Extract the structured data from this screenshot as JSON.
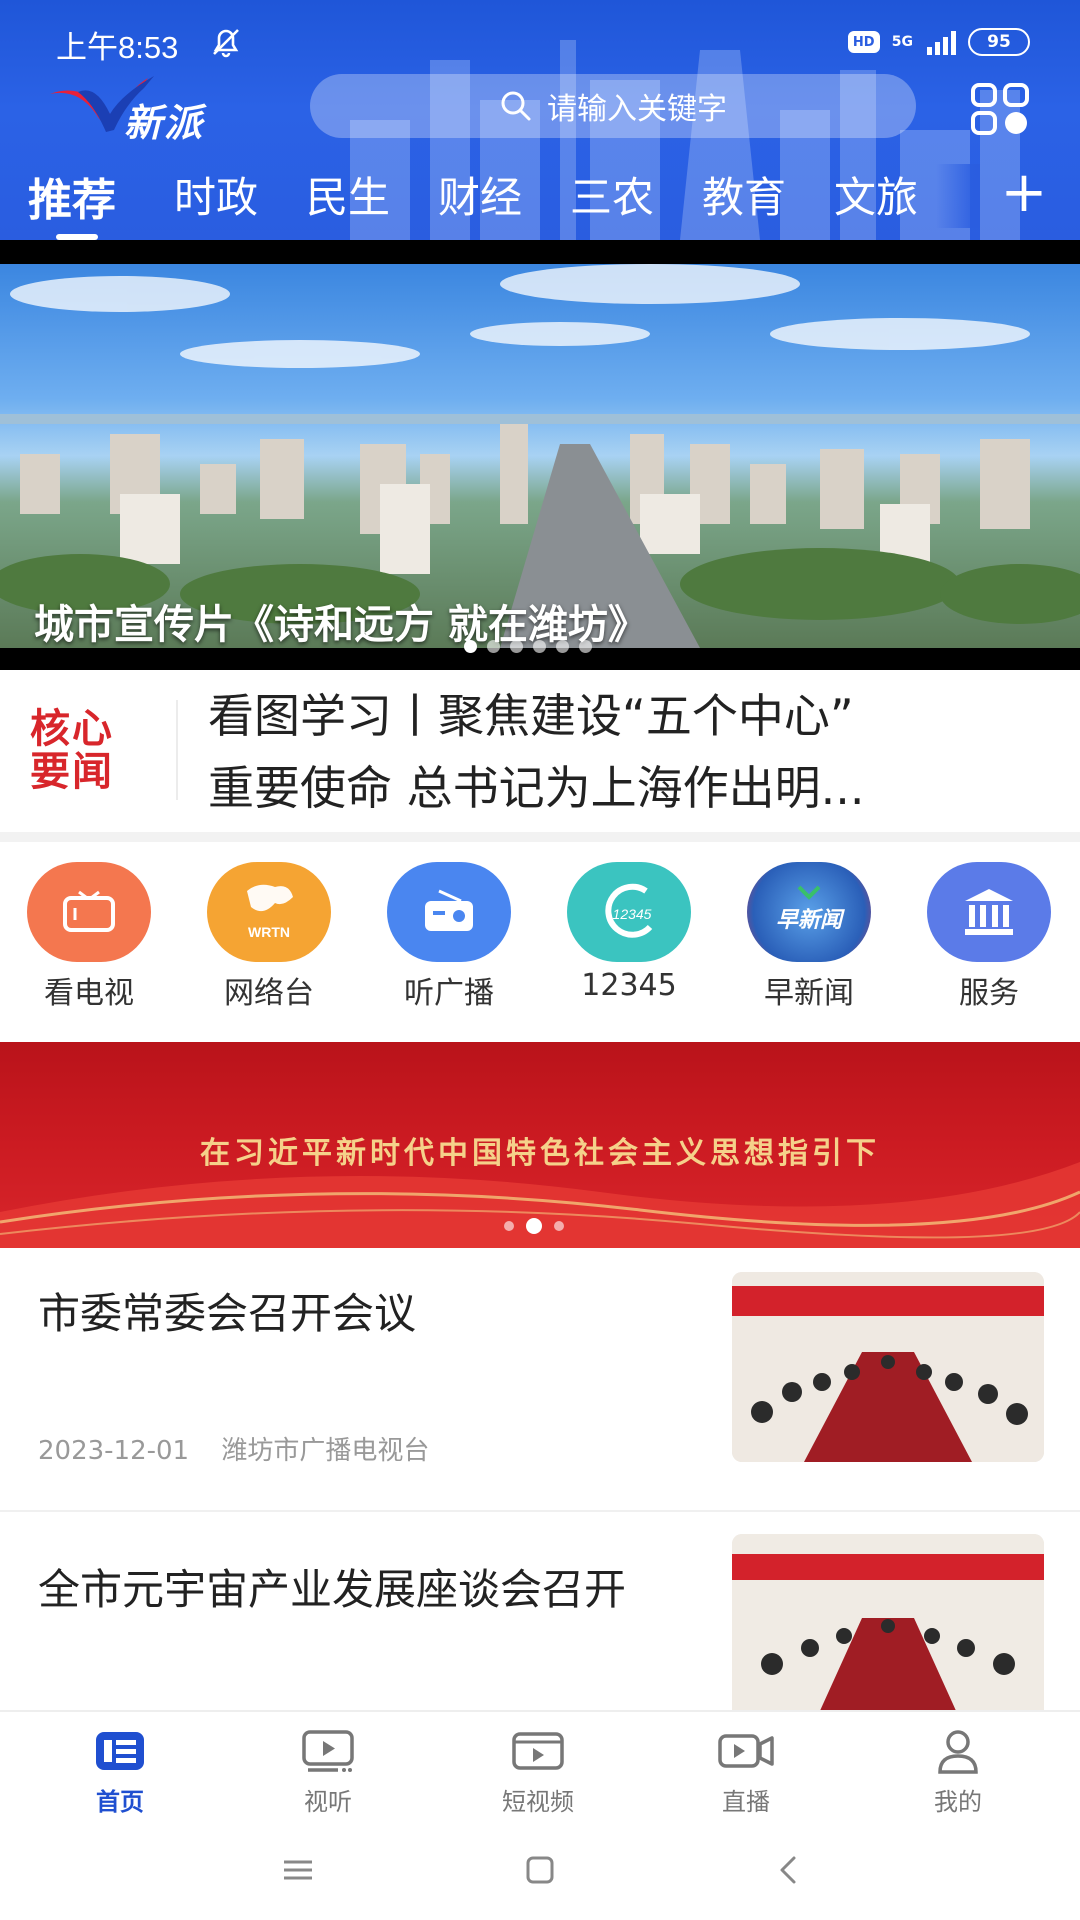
{
  "status_bar": {
    "time": "上午8:53",
    "hd": "HD",
    "network": "5G",
    "battery": "95"
  },
  "app": {
    "logo_text": "新派"
  },
  "search": {
    "placeholder": "请输入关键字"
  },
  "channels": [
    "推荐",
    "时政",
    "民生",
    "财经",
    "三农",
    "教育",
    "文旅"
  ],
  "banner": {
    "caption": "城市宣传片《诗和远方 就在潍坊》"
  },
  "core_news": {
    "badge_line1": "核心",
    "badge_line2": "要闻",
    "line1": "看图学习丨聚焦建设“五个中心”",
    "line2": "重要使命  总书记为上海作出明..."
  },
  "services": [
    {
      "label": "看电视",
      "icon": "tv-icon",
      "color": "#f4774f"
    },
    {
      "label": "网络台",
      "icon": "wrtn-icon",
      "color": "#f5a433",
      "badge": "WRTN"
    },
    {
      "label": "听广播",
      "icon": "radio-icon",
      "color": "#4a86f0"
    },
    {
      "label": "12345",
      "icon": "hotline-icon",
      "color": "#3bc4c0",
      "badge": "12345"
    },
    {
      "label": "早新闻",
      "icon": "morning-news-icon",
      "color": "#2a5fb8",
      "badge": "早新闻"
    },
    {
      "label": "服务",
      "icon": "service-building-icon",
      "color": "#5b7be8"
    }
  ],
  "red_banner": {
    "text": "在习近平新时代中国特色社会主义思想指引下"
  },
  "news": [
    {
      "title": "市委常委会召开会议",
      "date": "2023-12-01",
      "source": "潍坊市广播电视台"
    },
    {
      "title": "全市元宇宙产业发展座谈会召开"
    }
  ],
  "tabs": [
    {
      "label": "首页",
      "icon": "home-news-icon",
      "active": true
    },
    {
      "label": "视听",
      "icon": "audio-visual-icon",
      "active": false
    },
    {
      "label": "短视频",
      "icon": "short-video-icon",
      "active": false
    },
    {
      "label": "直播",
      "icon": "live-camera-icon",
      "active": false
    },
    {
      "label": "我的",
      "icon": "profile-icon",
      "active": false
    }
  ],
  "colors": {
    "brand_blue": "#2a5de0",
    "core_red": "#d8262b",
    "active_tab": "#1f4fd0"
  }
}
